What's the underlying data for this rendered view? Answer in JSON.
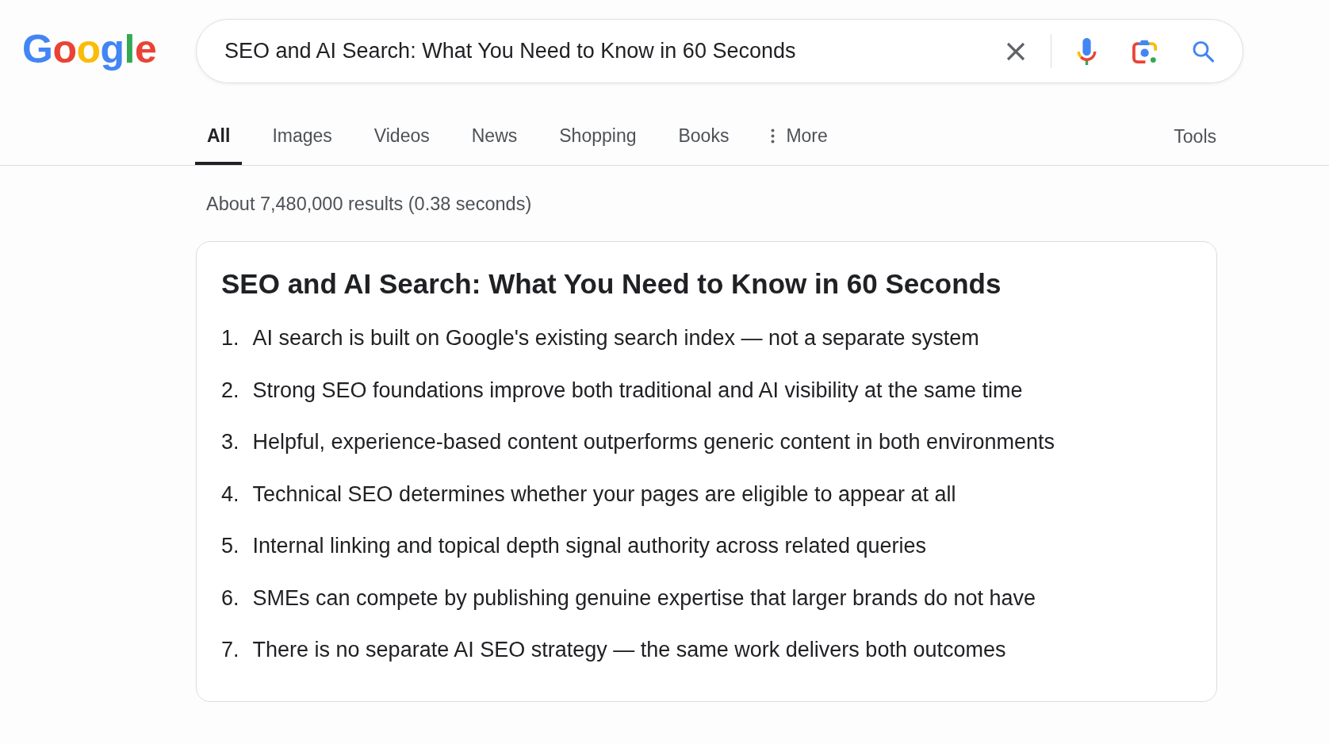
{
  "logo": {
    "letters": [
      {
        "letter": "G",
        "color": "#4285f4"
      },
      {
        "letter": "o",
        "color": "#ea4335"
      },
      {
        "letter": "o",
        "color": "#fbbc05"
      },
      {
        "letter": "g",
        "color": "#4285f4"
      },
      {
        "letter": "l",
        "color": "#34a853"
      },
      {
        "letter": "e",
        "color": "#ea4335"
      }
    ]
  },
  "search_bar": {
    "query": "SEO and AI Search: What You Need to Know in 60 Seconds"
  },
  "tabs": [
    {
      "label": "All",
      "selected": true,
      "kind": "link"
    },
    {
      "label": "Images",
      "selected": false,
      "kind": "link"
    },
    {
      "label": "Videos",
      "selected": false,
      "kind": "link"
    },
    {
      "label": "News",
      "selected": false,
      "kind": "link"
    },
    {
      "label": "Shopping",
      "selected": false,
      "kind": "link"
    },
    {
      "label": "Books",
      "selected": false,
      "kind": "link"
    },
    {
      "label": "More",
      "selected": false,
      "kind": "menu"
    }
  ],
  "tools": {
    "label": "Tools"
  },
  "result_stats": "About 7,480,000 results (0.38 seconds)",
  "snippet": {
    "title": "SEO and AI Search: What You Need to Know in 60 Seconds",
    "items": [
      {
        "number": "1.",
        "text": "AI search is built on Google's existing search index — not a separate system"
      },
      {
        "number": "2.",
        "text": "Strong SEO foundations improve both traditional and AI visibility at the same time"
      },
      {
        "number": "3.",
        "text": "Helpful, experience-based content outperforms generic content in both environments"
      },
      {
        "number": "4.",
        "text": "Technical SEO determines whether your pages are eligible to appear at all"
      },
      {
        "number": "5.",
        "text": "Internal linking and topical depth signal authority across related queries"
      },
      {
        "number": "6.",
        "text": "SMEs can compete by publishing genuine expertise that larger brands do not have"
      },
      {
        "number": "7.",
        "text": "There is no separate AI SEO strategy — the same work delivers both outcomes"
      }
    ]
  }
}
